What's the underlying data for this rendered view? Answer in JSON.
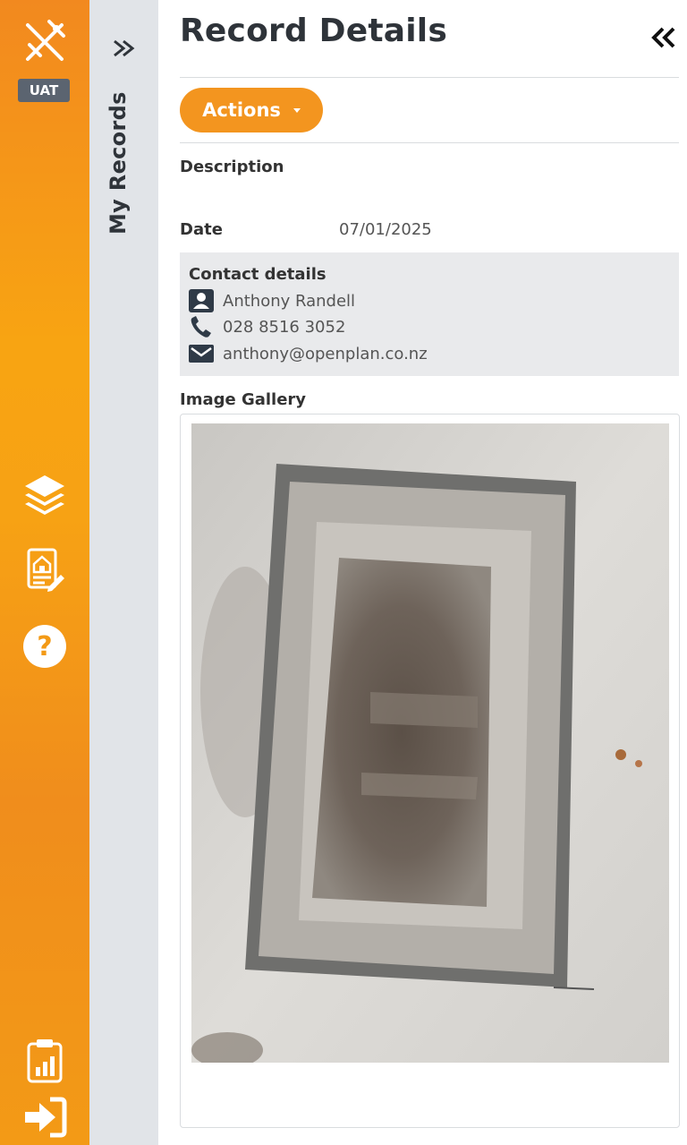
{
  "rail": {
    "env_badge": "UAT",
    "icons": [
      "app-logo-icon",
      "layers-icon",
      "property-report-icon",
      "help-icon",
      "clipboard-chart-icon",
      "sign-out-icon"
    ],
    "accent": "#f39a16"
  },
  "records_panel": {
    "label": "My Records"
  },
  "header": {
    "title": "Record Details"
  },
  "toolbar": {
    "actions_label": "Actions"
  },
  "fields": {
    "description_label": "Description",
    "description_value": "",
    "date_label": "Date",
    "date_value": "07/01/2025"
  },
  "contact": {
    "heading": "Contact details",
    "name": "Anthony Randell",
    "phone": "028 8516 3052",
    "email": "anthony@openplan.co.nz"
  },
  "gallery": {
    "heading": "Image Gallery"
  },
  "colors": {
    "primary": "#f3951f",
    "sidebar_grey": "#e1e4e8",
    "badge": "#5b6470",
    "contact_bg": "#e9eaec"
  }
}
